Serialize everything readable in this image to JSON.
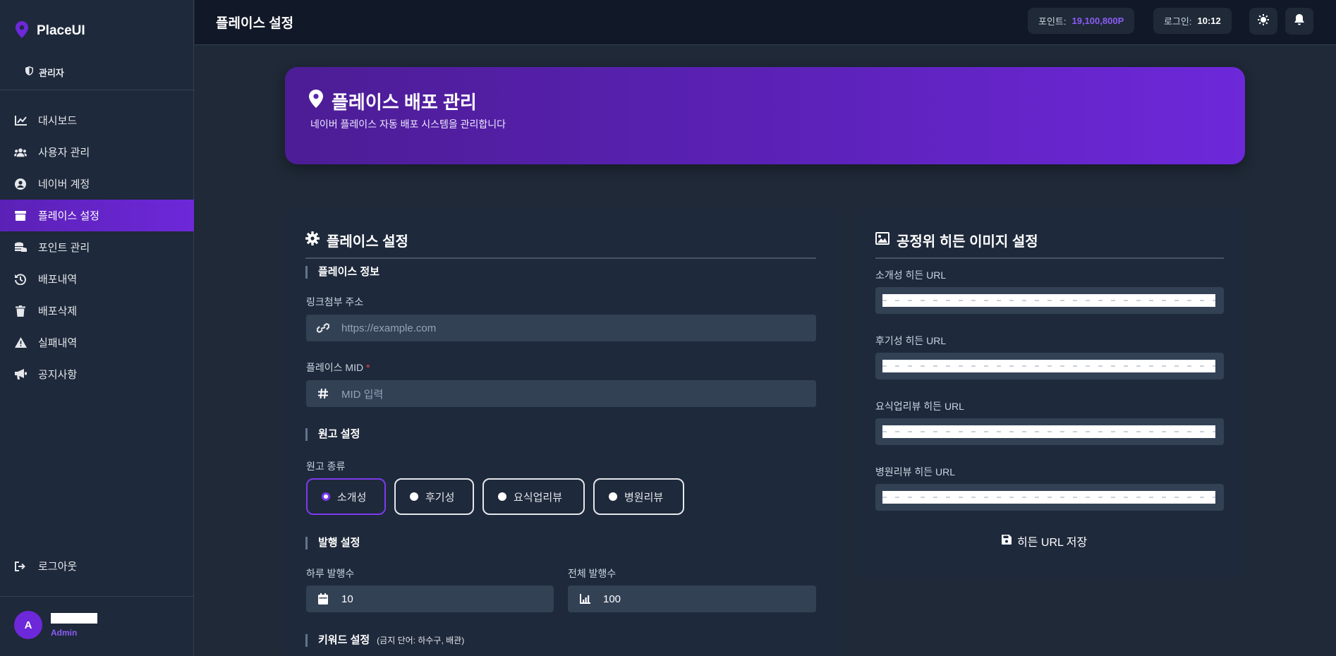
{
  "brand": {
    "name": "PlaceUI",
    "role": "관리자"
  },
  "nav": [
    {
      "label": "대시보드"
    },
    {
      "label": "사용자 관리"
    },
    {
      "label": "네이버 계정"
    },
    {
      "label": "플레이스 설정"
    },
    {
      "label": "포인트 관리"
    },
    {
      "label": "배포내역"
    },
    {
      "label": "배포삭제"
    },
    {
      "label": "실패내역"
    },
    {
      "label": "공지사항"
    }
  ],
  "logout": {
    "label": "로그아웃"
  },
  "user": {
    "avatar_letter": "A",
    "role": "Admin"
  },
  "header": {
    "title": "플레이스 설정",
    "points_label": "포인트:",
    "points_value": "19,100,800P",
    "login_label": "로그인:",
    "login_value": "10:12"
  },
  "banner": {
    "title": "플레이스 배포 관리",
    "subtitle": "네이버 플레이스 자동 배포 시스템을 관리합니다"
  },
  "place_settings": {
    "title": "플레이스 설정",
    "section_info": "플레이스 정보",
    "link_label": "링크첨부 주소",
    "link_placeholder": "https://example.com",
    "mid_label": "플레이스 MID",
    "mid_required": "*",
    "mid_placeholder": "MID 입력",
    "section_draft": "원고 설정",
    "draft_type_label": "원고 종류",
    "draft_types": [
      "소개성",
      "후기성",
      "요식업리뷰",
      "병원리뷰"
    ],
    "draft_selected": "소개성",
    "section_publish": "발행 설정",
    "daily_label": "하루 발행수",
    "daily_value": "10",
    "total_label": "전체 발행수",
    "total_value": "100",
    "section_keyword": "키워드 설정",
    "keyword_note": "(금지 단어: 하수구, 배관)"
  },
  "hidden_image": {
    "title": "공정위 히든 이미지 설정",
    "fields": [
      {
        "label": "소개성 히든 URL"
      },
      {
        "label": "후기성 히든 URL"
      },
      {
        "label": "요식업리뷰 히든 URL"
      },
      {
        "label": "병원리뷰 히든 URL"
      }
    ],
    "save_label": "히든 URL 저장"
  },
  "colors": {
    "accent": "#6d28d9",
    "accent_light": "#8b5cf6",
    "bg": "#1f2937",
    "panel": "#1e293b"
  }
}
